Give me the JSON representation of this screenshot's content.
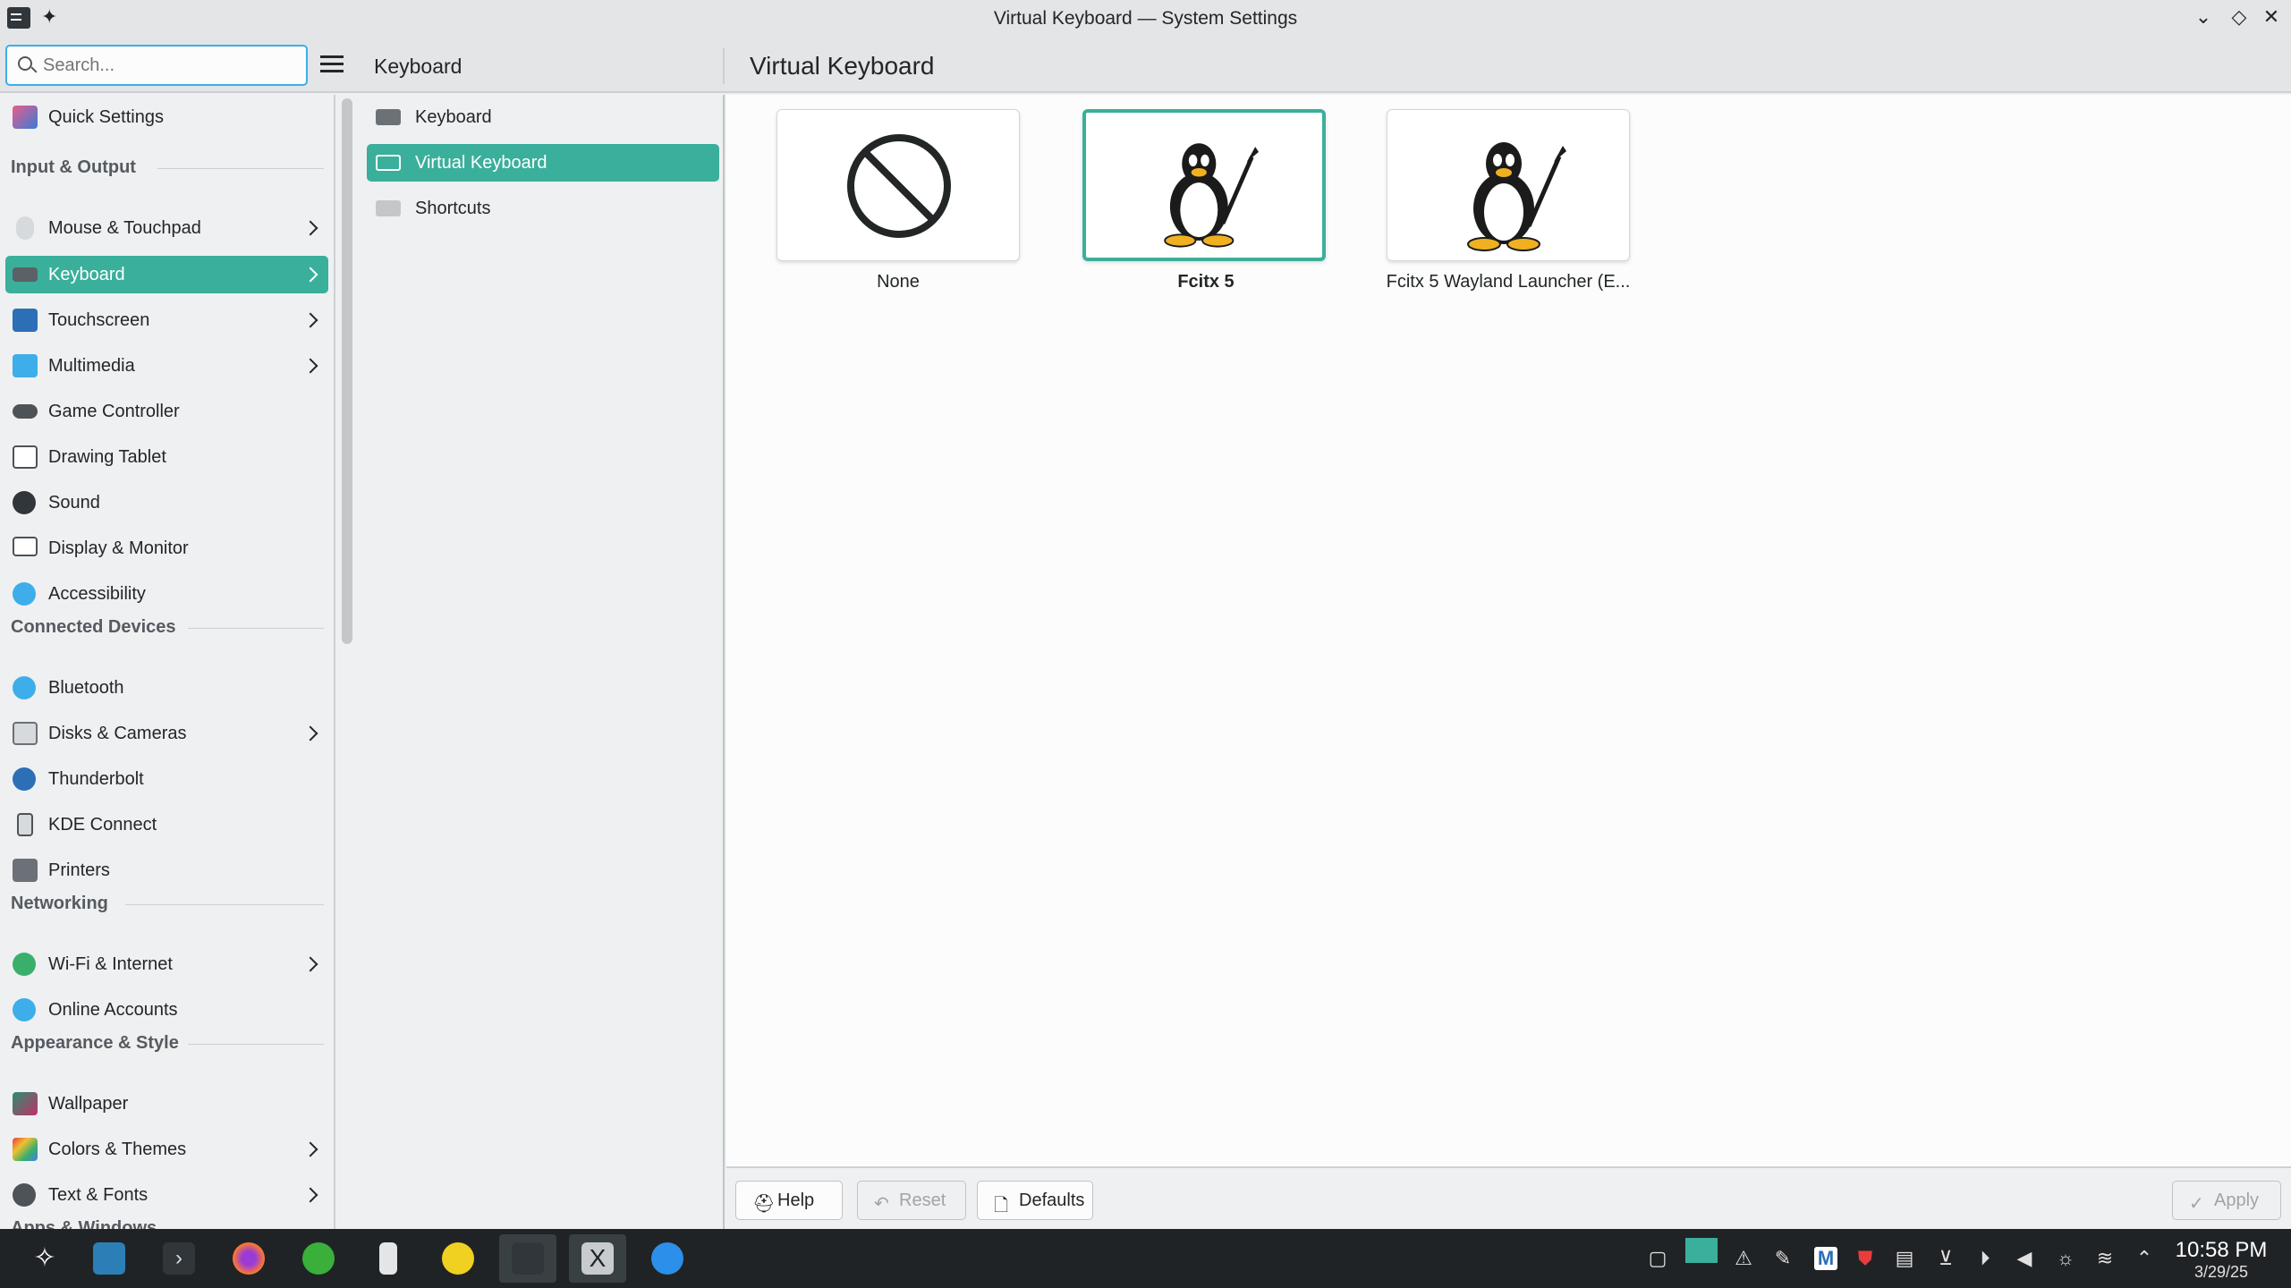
{
  "window": {
    "title": "Virtual Keyboard — System Settings"
  },
  "search": {
    "placeholder": "Search..."
  },
  "header": {
    "breadcrumb": "Keyboard",
    "page_title": "Virtual Keyboard"
  },
  "sidebar": {
    "quick_settings": "Quick Settings",
    "sections": {
      "input_output": "Input & Output",
      "connected_devices": "Connected Devices",
      "networking": "Networking",
      "appearance": "Appearance & Style",
      "apps_windows": "Apps & Windows"
    },
    "items": [
      {
        "label": "Mouse & Touchpad",
        "icon": "mouse-icon"
      },
      {
        "label": "Keyboard",
        "icon": "keyboard-icon"
      },
      {
        "label": "Touchscreen",
        "icon": "touchscreen-icon"
      },
      {
        "label": "Multimedia",
        "icon": "multimedia-icon"
      },
      {
        "label": "Game Controller",
        "icon": "gamepad-icon"
      },
      {
        "label": "Drawing Tablet",
        "icon": "tablet-icon"
      },
      {
        "label": "Sound",
        "icon": "speaker-icon"
      },
      {
        "label": "Display & Monitor",
        "icon": "monitor-icon"
      },
      {
        "label": "Accessibility",
        "icon": "accessibility-icon"
      },
      {
        "label": "Bluetooth",
        "icon": "bluetooth-icon"
      },
      {
        "label": "Disks & Cameras",
        "icon": "disk-icon"
      },
      {
        "label": "Thunderbolt",
        "icon": "thunderbolt-icon"
      },
      {
        "label": "KDE Connect",
        "icon": "phone-icon"
      },
      {
        "label": "Printers",
        "icon": "printer-icon"
      },
      {
        "label": "Wi-Fi & Internet",
        "icon": "globe-icon"
      },
      {
        "label": "Online Accounts",
        "icon": "accounts-icon"
      },
      {
        "label": "Wallpaper",
        "icon": "wallpaper-icon"
      },
      {
        "label": "Colors & Themes",
        "icon": "palette-icon"
      },
      {
        "label": "Text & Fonts",
        "icon": "fonts-icon"
      }
    ]
  },
  "subpages": [
    "Keyboard",
    "Virtual Keyboard",
    "Shortcuts"
  ],
  "options": [
    "None",
    "Fcitx 5",
    "Fcitx 5 Wayland Launcher (E..."
  ],
  "footer": {
    "help": "Help",
    "reset": "Reset",
    "defaults": "Defaults",
    "apply": "Apply"
  },
  "clock": {
    "time": "10:58 PM",
    "date": "3/29/25"
  },
  "colors": {
    "accent": "#3aaf9b",
    "taskbar": "#202326"
  }
}
